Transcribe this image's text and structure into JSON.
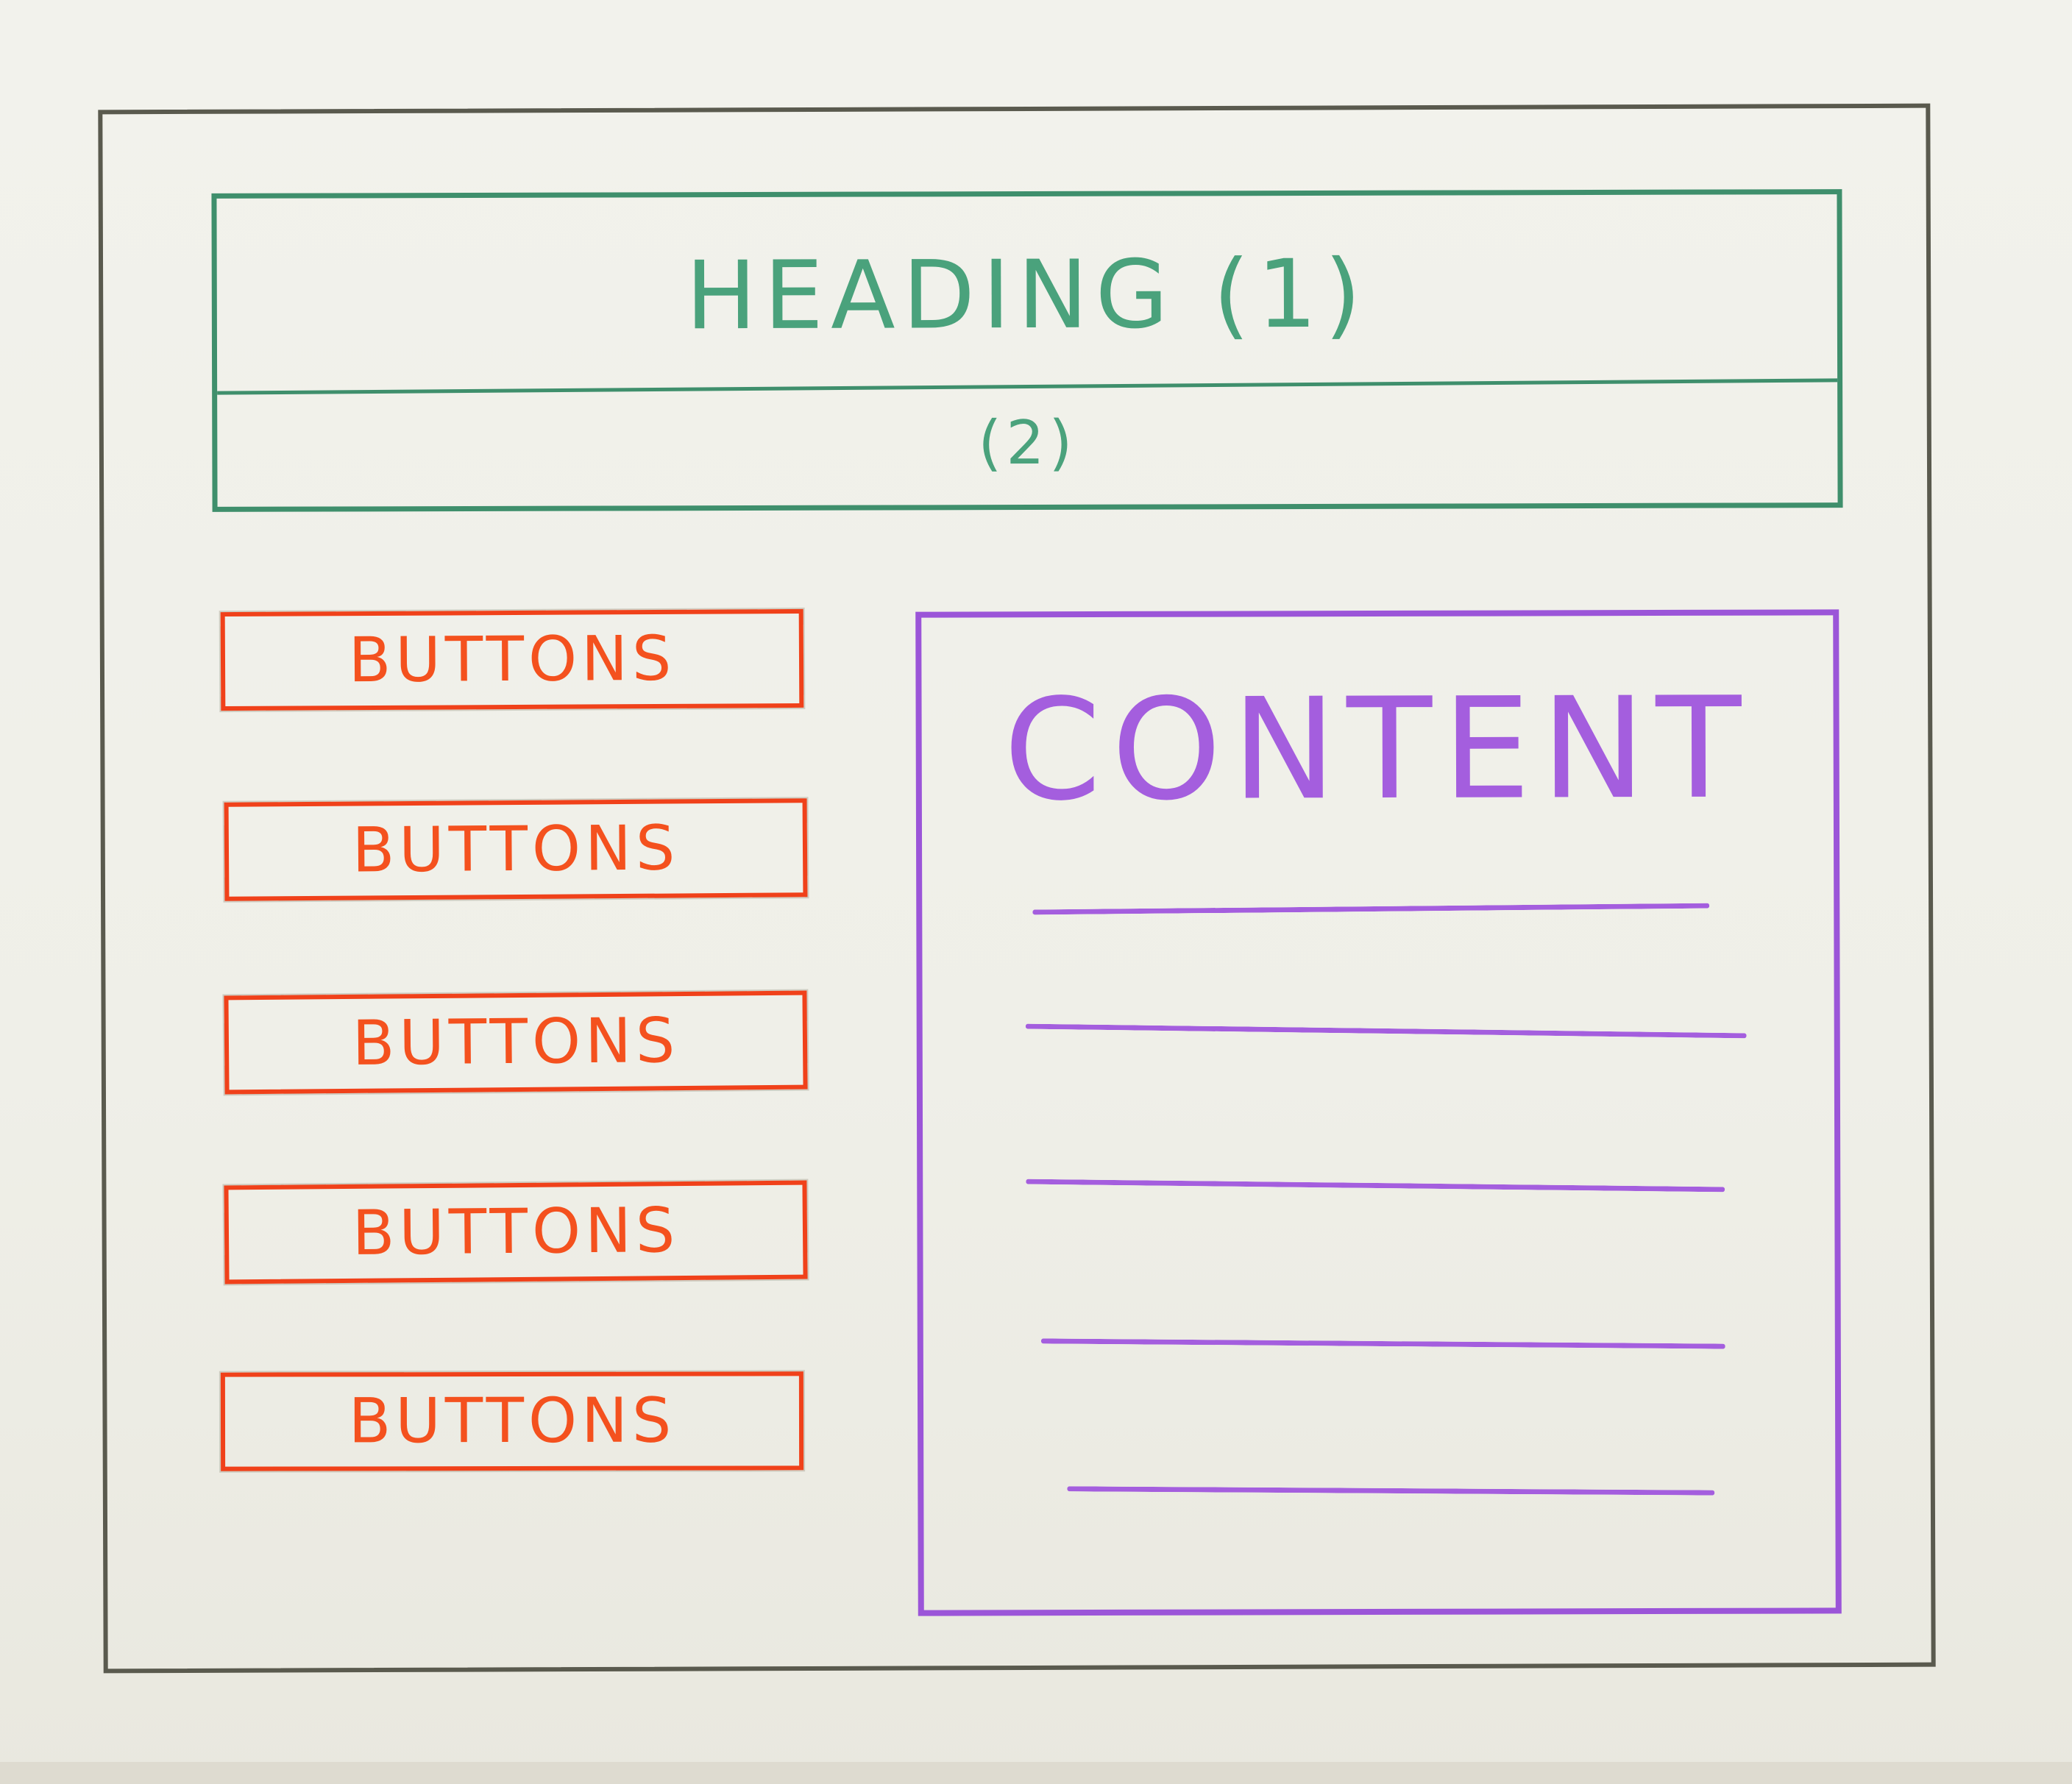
{
  "heading": {
    "title": "HEADING (1)",
    "subtitle": "(2)"
  },
  "sidebar": {
    "buttons": [
      {
        "label": "BUTTONS"
      },
      {
        "label": "BUTTONS"
      },
      {
        "label": "BUTTONS"
      },
      {
        "label": "BUTTONS"
      },
      {
        "label": "BUTTONS"
      }
    ]
  },
  "content": {
    "title": "CONTENT",
    "line_count": 5
  },
  "colors": {
    "frame": "#5a5a4e",
    "heading": "#4aa27c",
    "buttons": "#f0411a",
    "content": "#a45ede"
  }
}
